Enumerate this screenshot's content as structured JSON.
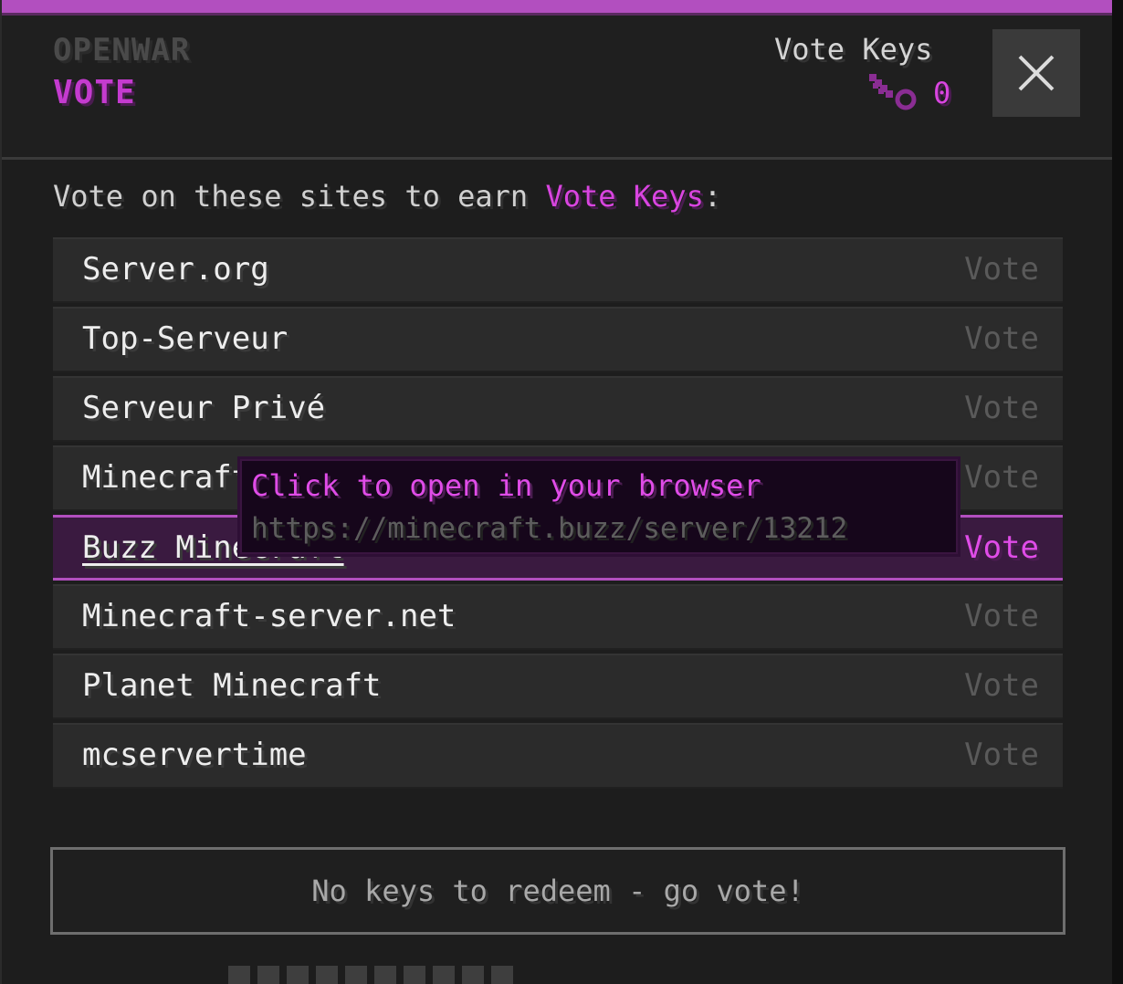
{
  "header": {
    "brand": "OPENWAR",
    "section": "VOTE",
    "keys_label": "Vote Keys",
    "keys_count": "0",
    "close_label": "×"
  },
  "intro": {
    "prefix": "Vote on these sites to earn ",
    "accent": "Vote Keys",
    "suffix": ":"
  },
  "sites": [
    {
      "name": "Server.org",
      "vote": "Vote"
    },
    {
      "name": "Top-Serveur",
      "vote": "Vote"
    },
    {
      "name": "Serveur Privé",
      "vote": "Vote"
    },
    {
      "name": "Minecraft-serverlist",
      "vote": "Vote"
    },
    {
      "name": "Buzz Minecraft",
      "vote": "Vote"
    },
    {
      "name": "Minecraft-server.net",
      "vote": "Vote"
    },
    {
      "name": "Planet Minecraft",
      "vote": "Vote"
    },
    {
      "name": "mcservertime",
      "vote": "Vote"
    }
  ],
  "tooltip": {
    "title": "Click to open in your browser",
    "url": "https://minecraft.buzz/server/13212"
  },
  "redeem_button": "No keys to redeem - go vote!",
  "colors": {
    "accent": "#d945e0",
    "active_border": "#b24fbf"
  }
}
